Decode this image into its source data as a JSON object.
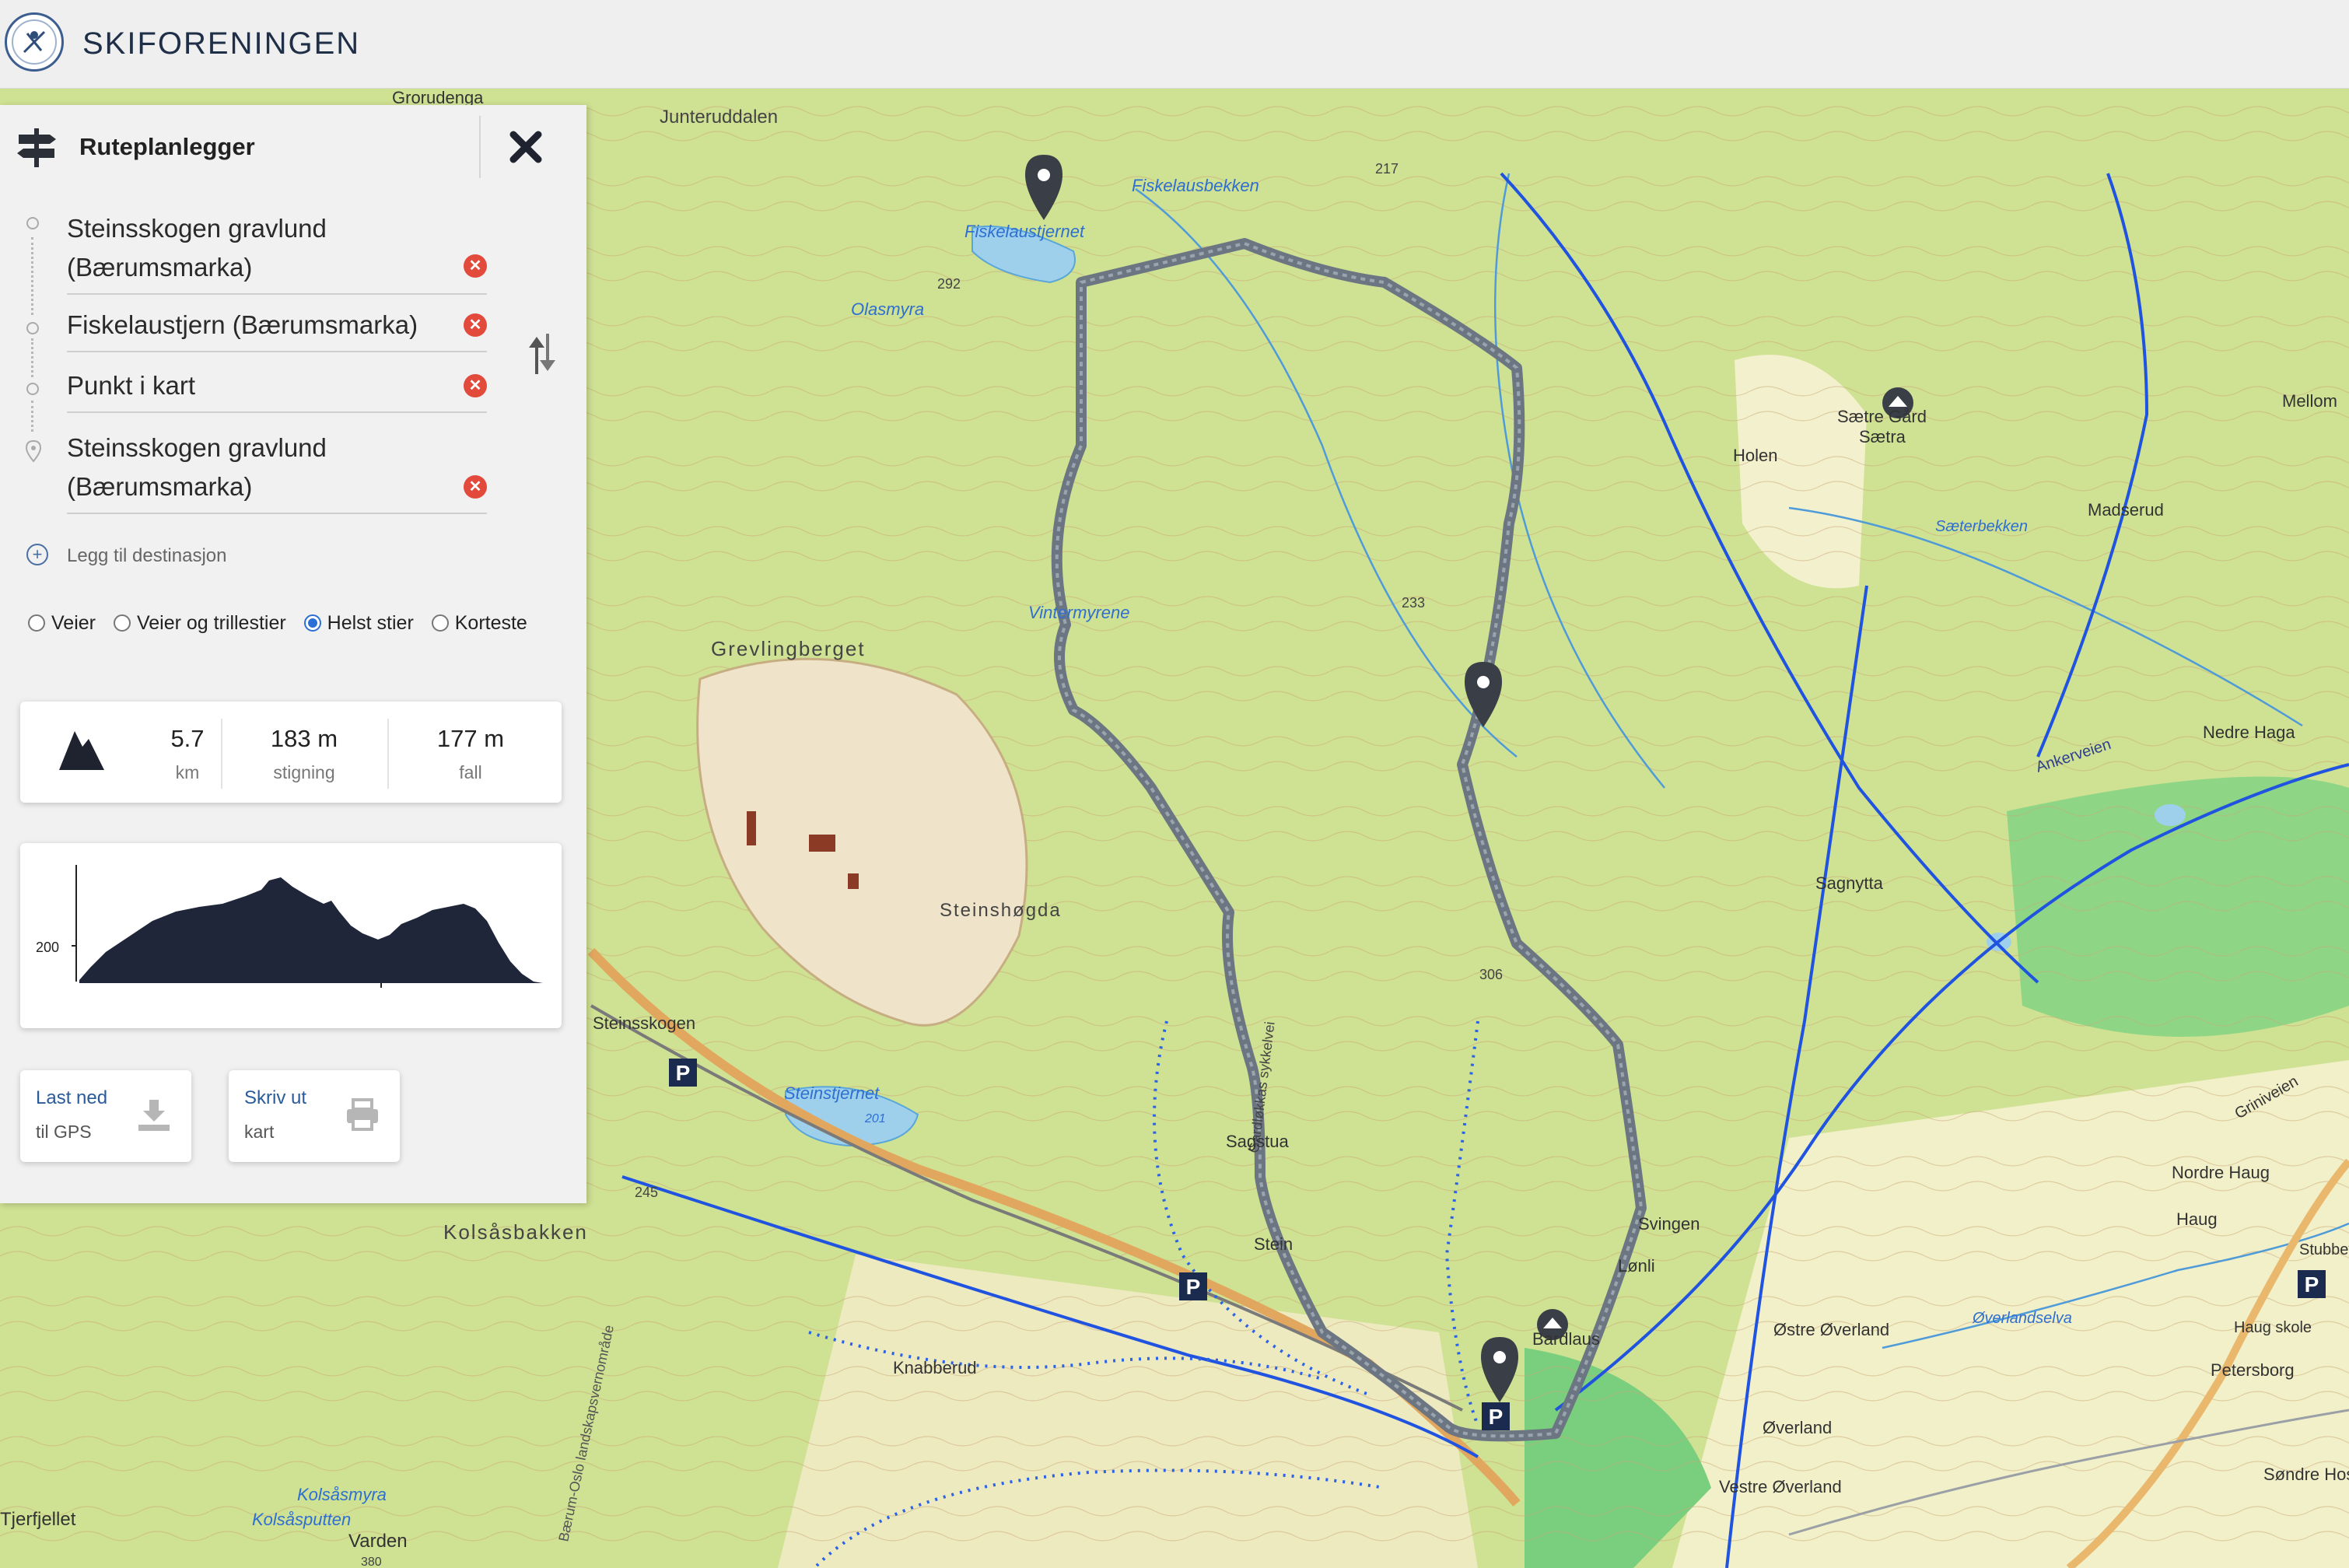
{
  "header": {
    "brand": "SKIFORENINGEN"
  },
  "panel": {
    "title": "Ruteplanlegger",
    "stops": [
      {
        "line1": "Steinsskogen gravlund",
        "line2": "(Bærumsmarka)"
      },
      {
        "line1": "Fiskelaustjern (Bærumsmarka)",
        "line2": ""
      },
      {
        "line1": "Punkt i kart",
        "line2": ""
      },
      {
        "line1": "Steinsskogen gravlund",
        "line2": "(Bærumsmarka)"
      }
    ],
    "add_destination": "Legg til destinasjon",
    "route_options": [
      {
        "label": "Veier",
        "selected": false
      },
      {
        "label": "Veier og trillestier",
        "selected": false
      },
      {
        "label": "Helst stier",
        "selected": true
      },
      {
        "label": "Korteste",
        "selected": false
      }
    ],
    "stats": {
      "distance": {
        "value": "5.7",
        "unit": "km"
      },
      "ascent": {
        "value": "183 m",
        "unit": "stigning"
      },
      "descent": {
        "value": "177 m",
        "unit": "fall"
      }
    },
    "profile": {
      "y_tick": "200"
    },
    "download": {
      "line1": "Last ned",
      "line2": "til GPS"
    },
    "print": {
      "line1": "Skriv ut",
      "line2": "kart"
    }
  },
  "map": {
    "labels": [
      "Grorudenga",
      "Junteruddalen",
      "Fiskelausbekken",
      "Fiskelaustjernet",
      "Olasmyra",
      "292",
      "217",
      "Vintermyrene",
      "233",
      "Grevlingberget",
      "Steinshøgda",
      "Gardløkkas sykkelvei",
      "Steinsskogen",
      "Steinstjernet",
      "201",
      "Sagstua",
      "Stein",
      "Kolsåsbakken",
      "Knabberud",
      "Kolsåsmyra",
      "Kolsåsputten",
      "Varden",
      "Tjerfjellet",
      "Sætre Gård",
      "Sætra",
      "Holen",
      "Madserud",
      "Mellom",
      "Sæterbekken",
      "Nedre Haga",
      "Ankerveien",
      "Sagnytta",
      "Svingen",
      "Lønli",
      "Bardlaus",
      "Østre Øverland",
      "Øverland",
      "Vestre Øverland",
      "Øverlandselva",
      "Nordre Haug",
      "Haug",
      "Haug skole",
      "Petersborg",
      "Søndre Hosle",
      "Griniveien",
      "Stubbeve",
      "306",
      "245",
      "380",
      "Bærum-Oslo landskapsvernområde"
    ]
  },
  "colors": {
    "accent": "#2a5b99",
    "route": "#6b7682",
    "trail": "#1f53e0",
    "delete": "#e24b3b",
    "profile_fill": "#20263a",
    "forest": "#c7dc88",
    "quarry": "#efe4c9",
    "water": "#9ed0ec"
  },
  "icons": {
    "planner": "signpost-icon",
    "close": "close-icon",
    "swap": "swap-icon",
    "elevation": "mountain-icon",
    "download": "download-icon",
    "print": "printer-icon"
  }
}
